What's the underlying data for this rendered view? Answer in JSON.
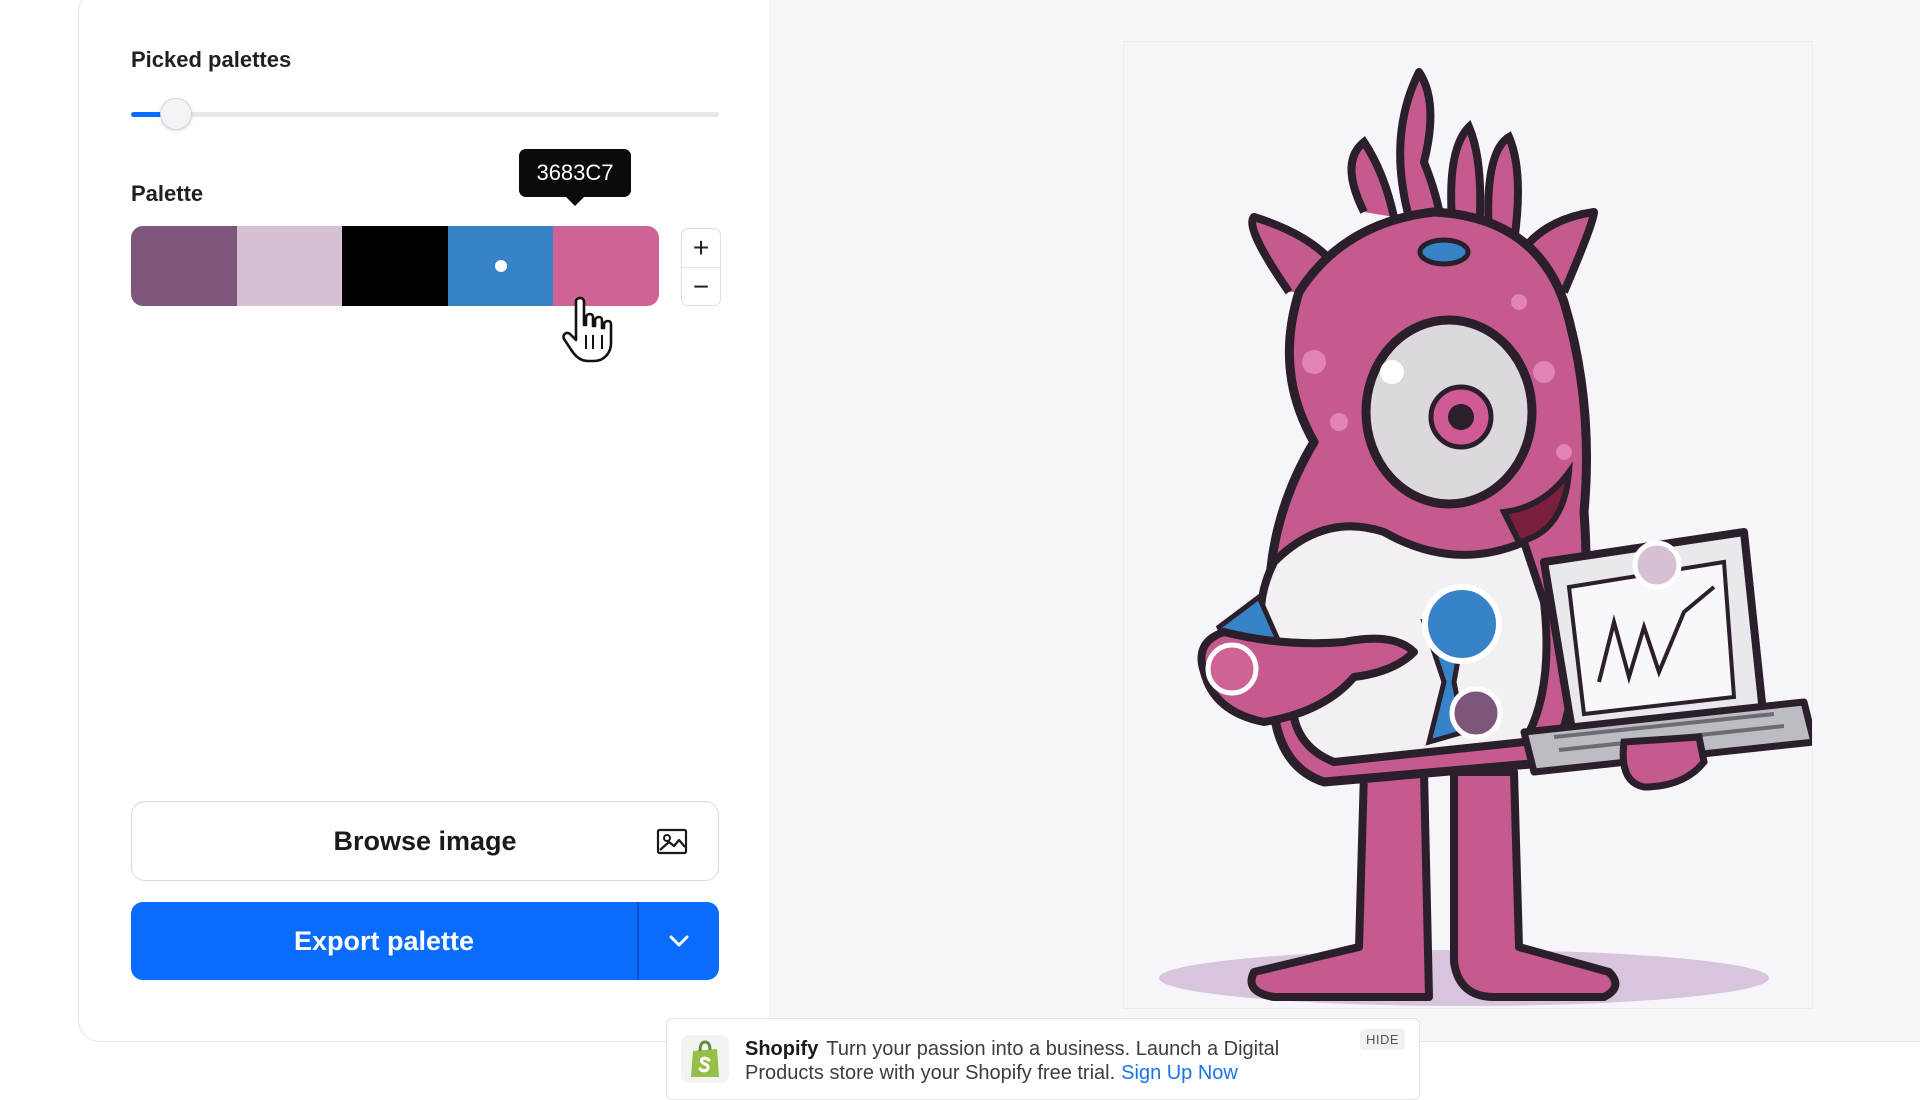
{
  "picked_palettes": {
    "label": "Picked palettes",
    "slider_value_fraction": 0.05
  },
  "palette": {
    "label": "Palette",
    "tooltip": "3683C7",
    "swatches": [
      {
        "color": "#7E567C"
      },
      {
        "color": "#D6C0D4"
      },
      {
        "color": "#000000"
      },
      {
        "color": "#3683C7",
        "selected": true
      },
      {
        "color": "#CF6395"
      }
    ],
    "add_symbol": "+",
    "remove_symbol": "−"
  },
  "actions": {
    "browse_label": "Browse image",
    "browse_icon": "image-icon",
    "export_label": "Export palette",
    "export_menu_icon": "chevron-down-icon"
  },
  "image": {
    "description_icon": "pink-monster-laptop-illustration",
    "picker_markers": [
      {
        "color": "#D6C0D4"
      },
      {
        "color": "#3683C7"
      },
      {
        "color": "#CF6395"
      },
      {
        "color": "#7E567C"
      }
    ]
  },
  "ad": {
    "brand": "Shopify",
    "text": "Turn your passion into a business. Launch a Digital Products store with your Shopify free trial.",
    "link": "Sign Up Now",
    "hide_label": "HIDE",
    "accent": "#95BF47"
  },
  "colors": {
    "accent": "#0A6CFF"
  }
}
